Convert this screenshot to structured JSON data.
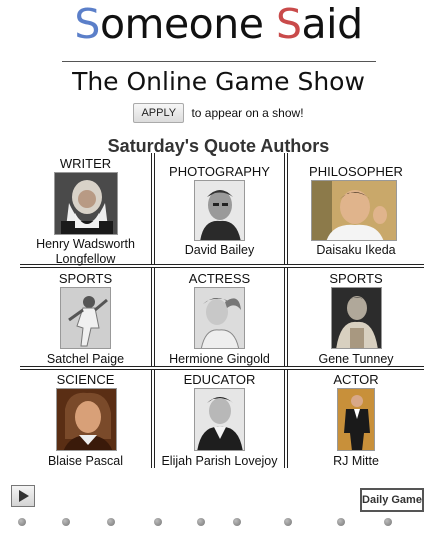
{
  "logo": {
    "s1": "S",
    "part1": "omeone ",
    "s2": "S",
    "part2": "aid"
  },
  "subtitle": "The Online Game Show",
  "apply": {
    "button_label": "APPLY",
    "text": "to appear on a show!"
  },
  "heading": "Saturday's Quote Authors",
  "authors": [
    {
      "category": "WRITER",
      "name": "Henry Wadsworth Longfellow"
    },
    {
      "category": "PHOTOGRAPHY",
      "name": "David Bailey"
    },
    {
      "category": "PHILOSOPHER",
      "name": "Daisaku Ikeda"
    },
    {
      "category": "SPORTS",
      "name": "Satchel Paige"
    },
    {
      "category": "ACTRESS",
      "name": "Hermione Gingold"
    },
    {
      "category": "SPORTS",
      "name": "Gene Tunney"
    },
    {
      "category": "SCIENCE",
      "name": "Blaise Pascal"
    },
    {
      "category": "EDUCATOR",
      "name": "Elijah Parish Lovejoy"
    },
    {
      "category": "ACTOR",
      "name": "RJ Mitte"
    }
  ],
  "footer": {
    "daily_game_label": "Daily Game"
  },
  "colors": {
    "logo_blue": "#5b7fc9",
    "logo_red": "#c94a4a"
  }
}
